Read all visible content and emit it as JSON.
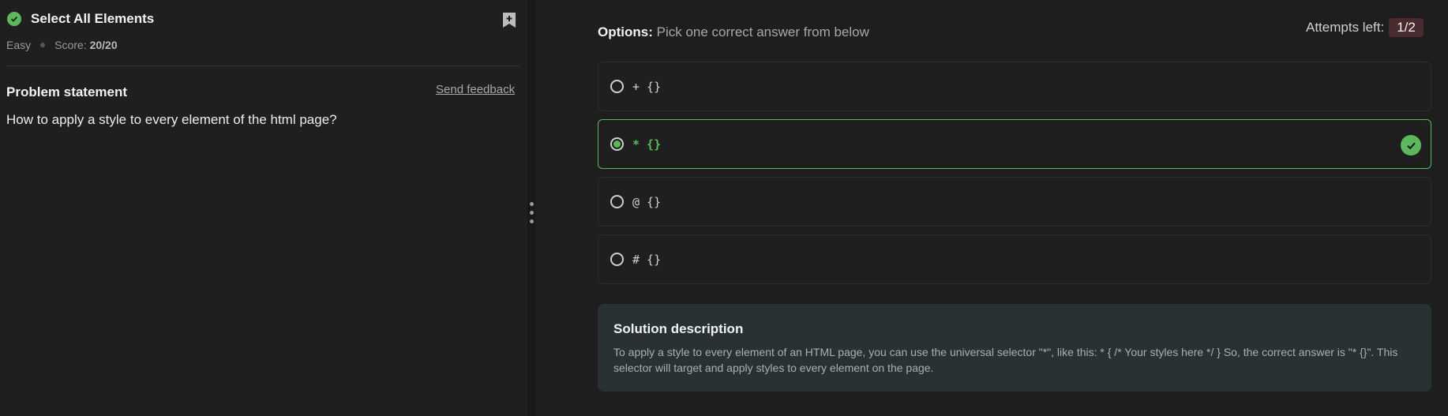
{
  "problem": {
    "title": "Select All Elements",
    "difficulty": "Easy",
    "score_label": "Score:",
    "score_value": "20/20",
    "statement_heading": "Problem statement",
    "send_feedback": "Send feedback",
    "statement_text": "How to apply a style to every element of the html page?"
  },
  "options_panel": {
    "label": "Options:",
    "hint": "Pick one correct answer from below",
    "attempts_label": "Attempts left:",
    "attempts_value": "1/2",
    "options": [
      {
        "text": "+ {}",
        "selected": false
      },
      {
        "text": "* {}",
        "selected": true
      },
      {
        "text": "@ {}",
        "selected": false
      },
      {
        "text": "# {}",
        "selected": false
      }
    ]
  },
  "solution": {
    "title": "Solution description",
    "text": "To apply a style to every element of an HTML page, you can use the universal selector \"*\", like this: * { /* Your styles here */ } So, the correct answer is \"* {}\". This selector will target and apply styles to every element on the page."
  },
  "colors": {
    "success": "#5cb85c",
    "attempts_badge": "#4a2c30",
    "solution_bg": "#2a3133"
  }
}
